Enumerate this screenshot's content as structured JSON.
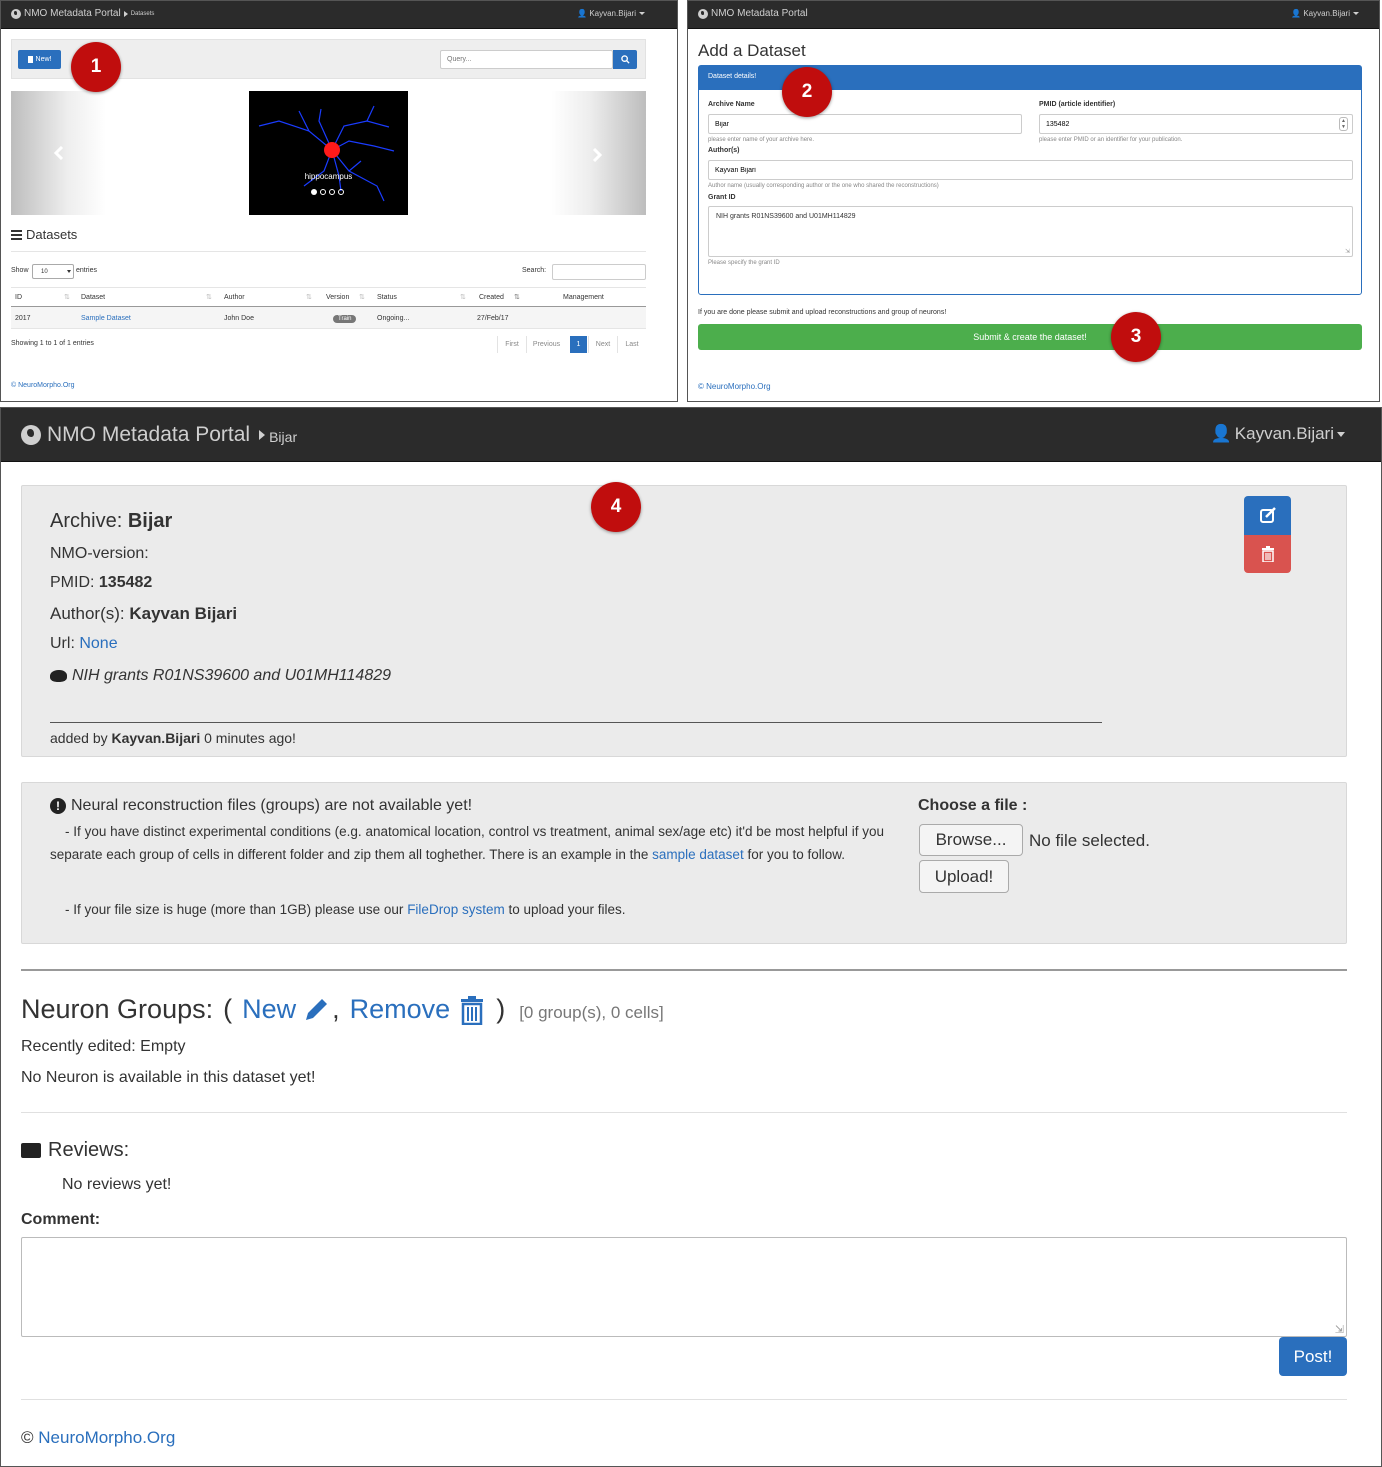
{
  "panel1": {
    "brand": "NMO Metadata Portal",
    "breadcrumb": "Datasets",
    "user": "Kayvan.Bijari",
    "new_button": "New!",
    "query_placeholder": "Query...",
    "carousel_caption": "hippocampus",
    "section_title": "Datasets",
    "show_label": "Show",
    "show_value": "10",
    "entries_label": "entries",
    "search_label": "Search:",
    "columns": [
      "ID",
      "Dataset",
      "Author",
      "Version",
      "Status",
      "Created",
      "Management"
    ],
    "row": {
      "id": "2017",
      "dataset": "Sample Dataset",
      "author": "John Doe",
      "version": "Train",
      "status": "Ongoing...",
      "created": "27/Feb/17"
    },
    "info": "Showing 1 to 1 of 1 entries",
    "pager": [
      "First",
      "Previous",
      "1",
      "Next",
      "Last"
    ],
    "footer": "© NeuroMorpho.Org"
  },
  "panel2": {
    "brand": "NMO Metadata Portal",
    "user": "Kayvan.Bijari",
    "title": "Add a Dataset",
    "box_header": "Dataset details!",
    "archive_label": "Archive Name",
    "archive_value": "Bijar",
    "archive_help": "please enter name of your archive here.",
    "pmid_label": "PMID (article identifier)",
    "pmid_value": "135482",
    "pmid_help": "please enter PMID or an identifier for your publication.",
    "authors_label": "Author(s)",
    "authors_value": "Kayvan Bijari",
    "authors_help": "Author name (usually corresponding author or the one who shared the reconstructions)",
    "grant_label": "Grant ID",
    "grant_value": "NIH grants R01NS39600 and U01MH114829",
    "grant_help": "Please specify the grant ID",
    "done_text": "If you are done please submit and upload reconstructions and group of neurons!",
    "submit_button": "Submit & create the dataset!",
    "footer": "© NeuroMorpho.Org"
  },
  "panel3": {
    "brand": "NMO Metadata Portal",
    "breadcrumb": "Bijar",
    "user": "Kayvan.Bijari",
    "archive_label": "Archive:",
    "archive_value": "Bijar",
    "nmo_version_label": "NMO-version:",
    "pmid_label": "PMID:",
    "pmid_value": "135482",
    "authors_label": "Author(s):",
    "authors_value": "Kayvan Bijari",
    "url_label": "Url:",
    "url_value": "None",
    "grant_text": "NIH grants R01NS39600 and U01MH114829",
    "added_prefix": "added by",
    "added_user": "Kayvan.Bijari",
    "added_suffix": "0 minutes ago!",
    "notice_title": "Neural reconstruction files (groups) are not available yet!",
    "notice_p1_a": "- If you have distinct experimental conditions (e.g. anatomical location, control vs treatment, animal sex/age etc) it'd be most helpful if you separate each group of cells in different folder and zip them all toghether. There is an example in the",
    "notice_p1_link": "sample dataset",
    "notice_p1_b": "for you to follow.",
    "notice_p2_a": "- If your file size is huge (more than 1GB) please use our",
    "notice_p2_link": "FileDrop system",
    "notice_p2_b": "to upload your files.",
    "choose_file_label": "Choose a file :",
    "browse_button": "Browse...",
    "no_file_text": "No file selected.",
    "upload_button": "Upload!",
    "groups_title": "Neuron Groups:",
    "groups_open": "(",
    "groups_new": "New",
    "groups_comma": ",",
    "groups_remove": "Remove",
    "groups_close": ")",
    "groups_count": "[0 group(s), 0 cells]",
    "recently_edited": "Recently edited: Empty",
    "no_neuron": "No Neuron is available in this dataset yet!",
    "reviews_title": "Reviews:",
    "no_reviews": "No reviews yet!",
    "comment_label": "Comment:",
    "post_button": "Post!",
    "footer_copy": "©",
    "footer_link": "NeuroMorpho.Org"
  },
  "step_badges": [
    "1",
    "2",
    "3",
    "4"
  ],
  "colors": {
    "navbar": "#2b2b2b",
    "primary": "#2a6fbd",
    "success": "#4cae4c",
    "danger": "#d9534f",
    "badge": "#c00d0d"
  }
}
